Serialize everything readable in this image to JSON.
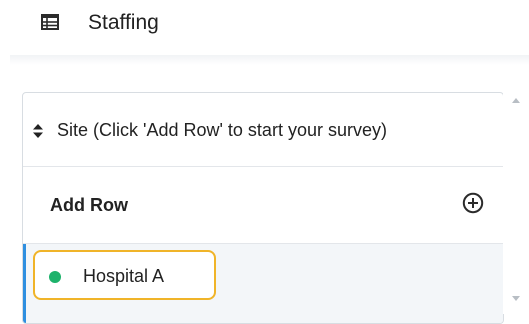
{
  "header": {
    "title": "Staffing",
    "icon": "table-icon"
  },
  "list": {
    "sort_label": "Site (Click 'Add Row' to start your survey)",
    "add_row_label": "Add Row",
    "rows": [
      {
        "label": "Hospital A",
        "status_color": "#1db26b"
      }
    ]
  },
  "colors": {
    "accent_blue": "#2e8fe0",
    "highlight_yellow": "#f0b429",
    "status_green": "#1db26b"
  }
}
